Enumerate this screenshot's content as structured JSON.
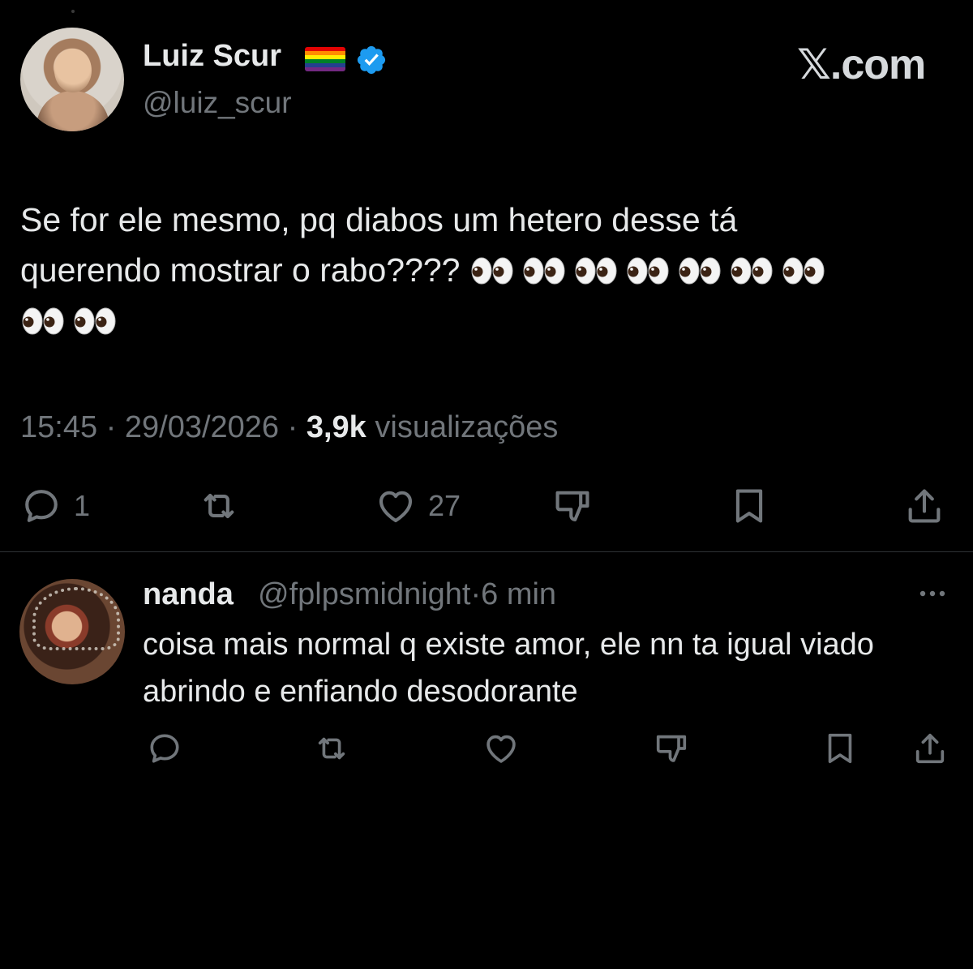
{
  "colors": {
    "background": "#000000",
    "text_primary": "#e7e9ea",
    "text_secondary": "#71767b",
    "verified_blue": "#1d9bf0",
    "divider": "#2f3336"
  },
  "tweet": {
    "author": {
      "display_name": "Luiz Scur",
      "handle": "@luiz_scur",
      "flag": "rainbow-flag-icon",
      "verified": true
    },
    "brand": "𝕏.com",
    "text_line1": "Se for ele mesmo, pq diabos um hetero desse tá",
    "text_line2": "querendo mostrar o rabo????",
    "eyes_emoji_count": 9,
    "time": "15:45",
    "date": "29/03/2026",
    "views_count": "3,9k",
    "views_label": "visualizações",
    "separator": "·",
    "actions": {
      "reply_count": "1",
      "retweet_count": "",
      "like_count": "27"
    }
  },
  "reply": {
    "display_name": "nanda",
    "handle": "@fplpsmidnight",
    "time": "6 min",
    "separator": "·",
    "text": "coisa mais normal q existe amor, ele nn ta igual viado abrindo e enfiando desodorante"
  }
}
